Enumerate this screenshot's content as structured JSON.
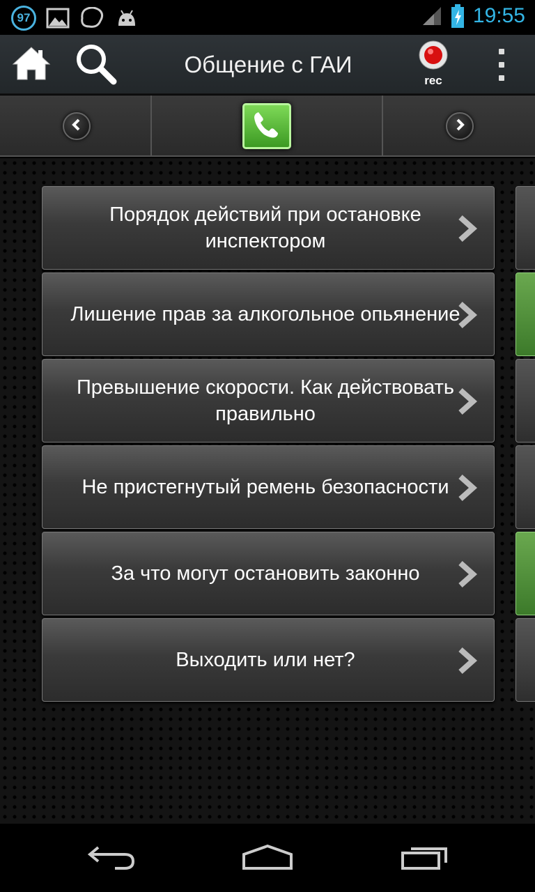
{
  "status_bar": {
    "notification_count": "97",
    "time": "19:55",
    "icons": [
      "badge-97-icon",
      "image-icon",
      "messenger-icon",
      "android-icon",
      "signal-icon",
      "battery-charging-icon"
    ]
  },
  "action_bar": {
    "title": "Общение с ГАИ",
    "rec_label": "rec",
    "icons": [
      "home-icon",
      "search-icon",
      "record-icon",
      "overflow-menu-icon"
    ]
  },
  "tab_strip": {
    "icons": [
      "chevron-left-icon",
      "phone-icon",
      "chevron-right-icon"
    ]
  },
  "menu_items": [
    {
      "label": "Порядок действий при остановке инспектором"
    },
    {
      "label": "Лишение прав за алкогольное опьянение"
    },
    {
      "label": "Превышение скорости. Как действовать правильно"
    },
    {
      "label": "Не пристегнутый ремень безопасности"
    },
    {
      "label": "За что могут остановить законно"
    },
    {
      "label": "Выходить или нет?"
    }
  ],
  "side_cards": [
    "gray",
    "green",
    "gray",
    "gray",
    "green",
    "gray"
  ],
  "nav_bar": {
    "icons": [
      "back-icon",
      "home-nav-icon",
      "recent-apps-icon"
    ]
  },
  "colors": {
    "accent": "#33b5e5",
    "call_button": "#4fb52f",
    "side_card_green": "#6aa84f"
  }
}
